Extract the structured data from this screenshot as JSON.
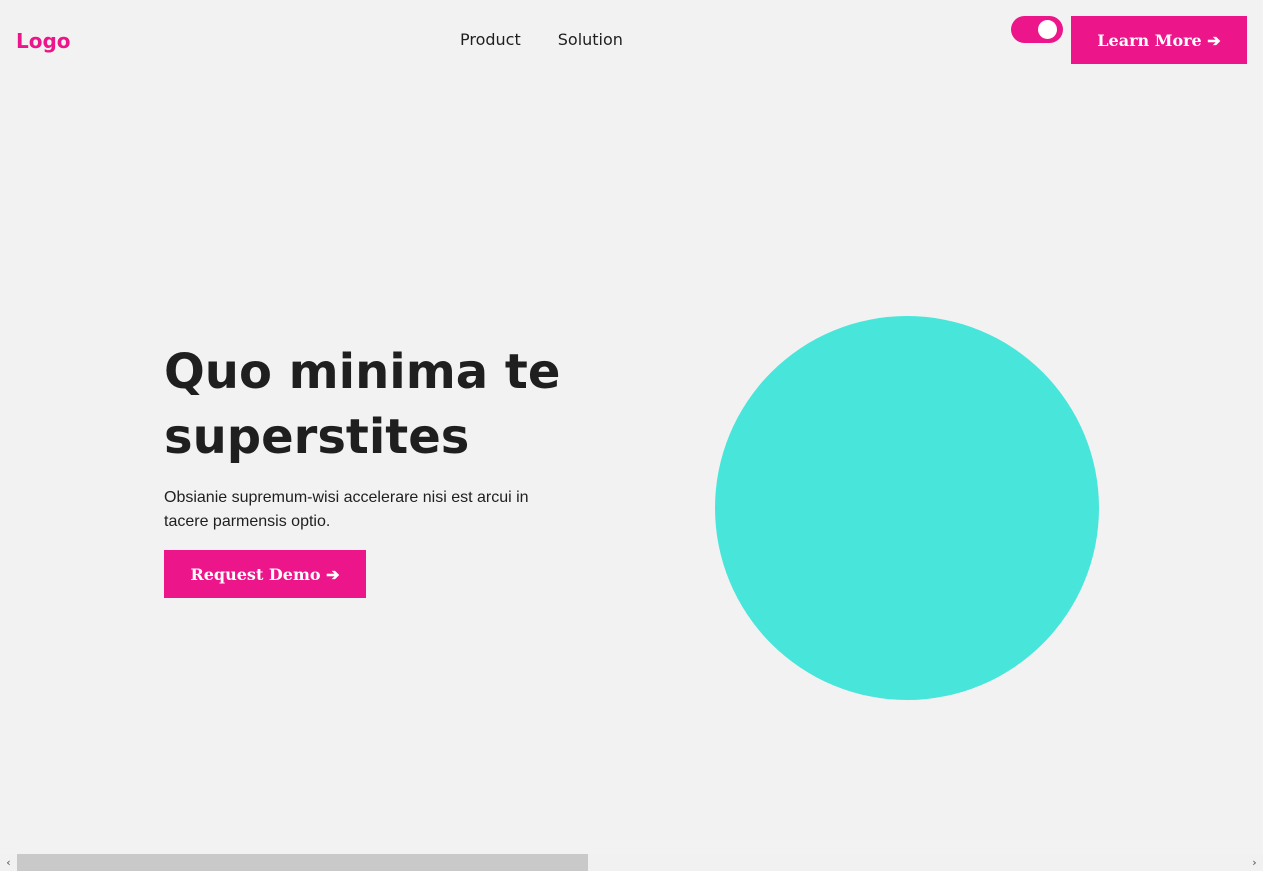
{
  "header": {
    "logo": "Logo",
    "nav": {
      "product": "Product",
      "solution": "Solution"
    },
    "toggle_state": "on",
    "learn_more_label": "Learn More ➔"
  },
  "hero": {
    "title": "Quo minima te superstites",
    "description": "Obsianie supremum-wisi accelerare nisi est arcui in tacere parmensis optio.",
    "cta_label": "Request Demo ➔"
  },
  "scrollbar": {
    "left_arrow": "‹",
    "right_arrow": "›"
  },
  "colors": {
    "accent": "#ec1589",
    "circle": "#48e5da",
    "background": "#f2f2f2",
    "text": "#1f1f1f"
  },
  "icons": {
    "toggle": "toggle-switch-icon",
    "decorative": "circle-shape"
  }
}
